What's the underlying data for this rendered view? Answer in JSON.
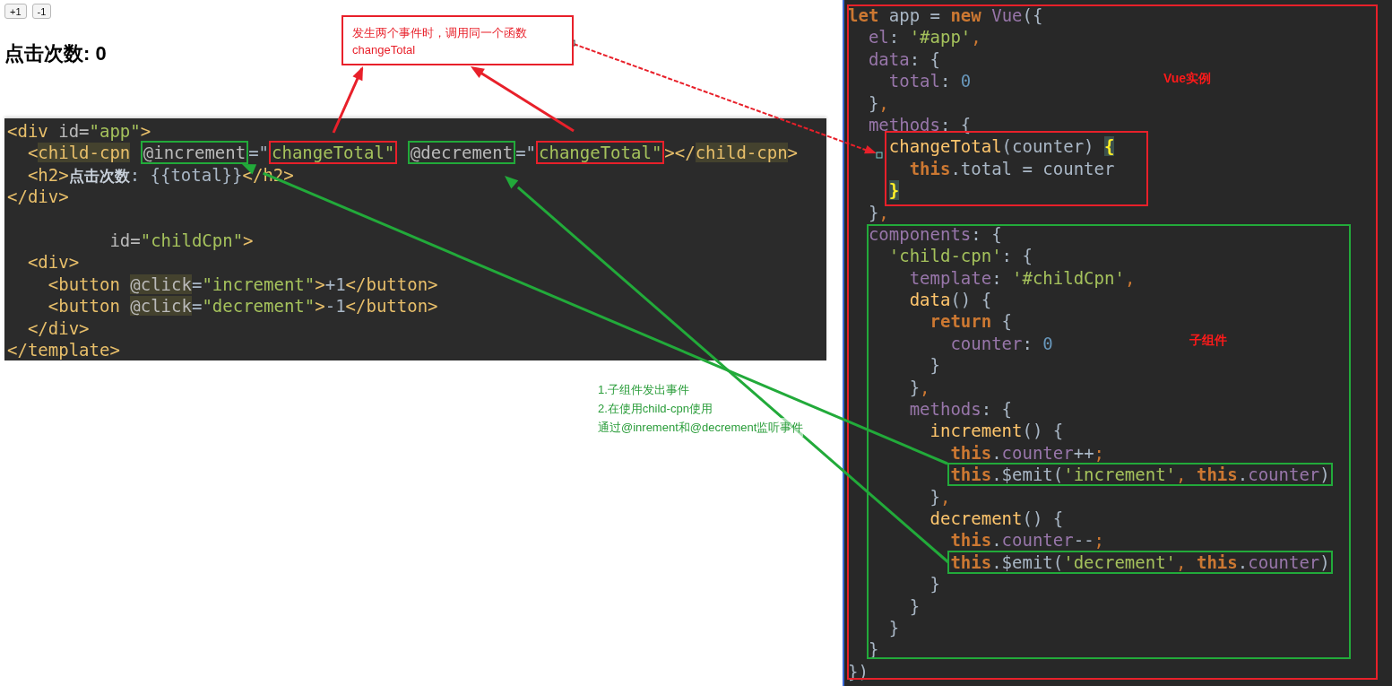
{
  "preview": {
    "buttons": [
      "+1",
      "-1"
    ],
    "heading": "点击次数: 0"
  },
  "callout": {
    "lines": [
      "发生两个事件时，调用同一个函数",
      "changeTotal"
    ]
  },
  "note": {
    "lines": [
      "1.子组件发出事件",
      "2.在使用child-cpn使用",
      "通过@inrement和@decrement监听事件"
    ]
  },
  "template_code": {
    "lines": [
      {
        "kind": "code",
        "tokens": [
          {
            "text": "<div",
            "kind": "tag"
          },
          {
            "text": " id=",
            "kind": "attr"
          },
          {
            "text": "\"app\"",
            "kind": "str"
          },
          {
            "text": ">",
            "kind": "tag"
          }
        ]
      },
      {
        "kind": "code",
        "tokens": [
          {
            "text": "  <",
            "kind": "tag"
          },
          {
            "text": "child-cpn",
            "kind": "tag",
            "highlight": true
          },
          {
            "text": " @increment",
            "kind": "attr",
            "color": "#22aa3a"
          },
          {
            "text": "=\"",
            "kind": "plain"
          },
          {
            "text": "changeTotal\"",
            "kind": "str",
            "color": "#e8202a"
          },
          {
            "text": " @decrement",
            "kind": "attr",
            "color": "#22aa3a"
          },
          {
            "text": "=\"",
            "kind": "plain"
          },
          {
            "text": "changeTotal\"",
            "kind": "str",
            "color": "#e8202a"
          },
          {
            "text": "></",
            "kind": "tag"
          },
          {
            "text": "child-cpn",
            "kind": "tag",
            "highlight": true
          },
          {
            "text": ">",
            "kind": "tag"
          }
        ]
      },
      {
        "kind": "code",
        "tokens": [
          {
            "text": "  <h2>",
            "kind": "tag"
          },
          {
            "text": "点击次数",
            "kind": "cjk"
          },
          {
            "text": ": {{total}}",
            "kind": "plain"
          },
          {
            "text": "</h2>",
            "kind": "tag"
          }
        ]
      },
      {
        "kind": "code",
        "tokens": [
          {
            "text": "</div>",
            "kind": "tag"
          }
        ]
      },
      {
        "kind": "blank"
      },
      {
        "kind": "code",
        "tokens": [
          {
            "text": "          id=",
            "kind": "attr"
          },
          {
            "text": "\"childCpn\"",
            "kind": "str"
          },
          {
            "text": ">",
            "kind": "tag"
          }
        ]
      },
      {
        "kind": "code",
        "tokens": [
          {
            "text": "  <div>",
            "kind": "tag"
          }
        ]
      },
      {
        "kind": "code",
        "tokens": [
          {
            "text": "    <button",
            "kind": "tag"
          },
          {
            "text": " @click",
            "kind": "attr",
            "highlight": true
          },
          {
            "text": "=",
            "kind": "plain"
          },
          {
            "text": "\"increment\"",
            "kind": "str"
          },
          {
            "text": ">",
            "kind": "tag"
          },
          {
            "text": "+1",
            "kind": "plain"
          },
          {
            "text": "</button>",
            "kind": "tag"
          }
        ]
      },
      {
        "kind": "code",
        "tokens": [
          {
            "text": "    <button",
            "kind": "tag"
          },
          {
            "text": " @click",
            "kind": "attr",
            "highlight": true
          },
          {
            "text": "=",
            "kind": "plain"
          },
          {
            "text": "\"decrement\"",
            "kind": "str"
          },
          {
            "text": ">",
            "kind": "tag"
          },
          {
            "text": "-1",
            "kind": "plain"
          },
          {
            "text": "</button>",
            "kind": "tag"
          }
        ]
      },
      {
        "kind": "code",
        "tokens": [
          {
            "text": "  </div>",
            "kind": "tag"
          }
        ]
      },
      {
        "kind": "code",
        "tokens": [
          {
            "text": "</template>",
            "kind": "tag"
          }
        ]
      }
    ]
  },
  "script_code": {
    "labels": [
      "Vue实例",
      "子组件"
    ],
    "lines": [
      {
        "kind": "code",
        "tokens": [
          {
            "text": "let",
            "kind": "kw"
          },
          {
            "text": " app = ",
            "kind": "plain"
          },
          {
            "text": "new",
            "kind": "kw"
          },
          {
            "text": " Vue",
            "kind": "prop"
          },
          {
            "text": "({",
            "kind": "plain"
          }
        ]
      },
      {
        "kind": "code",
        "tokens": [
          {
            "text": "  el",
            "kind": "prop"
          },
          {
            "text": ": ",
            "kind": "plain"
          },
          {
            "text": "'#app'",
            "kind": "str"
          },
          {
            "text": ",",
            "kind": "punct"
          }
        ]
      },
      {
        "kind": "code",
        "tokens": [
          {
            "text": "  data",
            "kind": "prop"
          },
          {
            "text": ": {",
            "kind": "plain"
          }
        ]
      },
      {
        "kind": "code",
        "tokens": [
          {
            "text": "    total",
            "kind": "prop"
          },
          {
            "text": ": ",
            "kind": "plain"
          },
          {
            "text": "0",
            "kind": "num"
          }
        ]
      },
      {
        "kind": "code",
        "tokens": [
          {
            "text": "  }",
            "kind": "plain"
          },
          {
            "text": ",",
            "kind": "punct"
          }
        ]
      },
      {
        "kind": "code",
        "tokens": [
          {
            "text": "  methods",
            "kind": "prop"
          },
          {
            "text": ": {",
            "kind": "plain"
          }
        ]
      },
      {
        "kind": "code",
        "tokens": [
          {
            "text": "    changeTotal",
            "kind": "fn"
          },
          {
            "text": "(counter) ",
            "kind": "plain"
          },
          {
            "text": "{",
            "kind": "brace"
          }
        ]
      },
      {
        "kind": "code",
        "tokens": [
          {
            "text": "      this",
            "kind": "kw"
          },
          {
            "text": ".total = counter",
            "kind": "plain"
          }
        ]
      },
      {
        "kind": "code",
        "tokens": [
          {
            "text": "    }",
            "kind": "brace"
          }
        ]
      },
      {
        "kind": "code",
        "tokens": [
          {
            "text": "  }",
            "kind": "plain"
          },
          {
            "text": ",",
            "kind": "punct"
          }
        ]
      },
      {
        "kind": "code",
        "tokens": [
          {
            "text": "  components",
            "kind": "prop"
          },
          {
            "text": ": {",
            "kind": "plain"
          }
        ]
      },
      {
        "kind": "code",
        "tokens": [
          {
            "text": "    'child-cpn'",
            "kind": "str"
          },
          {
            "text": ": {",
            "kind": "plain"
          }
        ]
      },
      {
        "kind": "code",
        "tokens": [
          {
            "text": "      template",
            "kind": "prop"
          },
          {
            "text": ": ",
            "kind": "plain"
          },
          {
            "text": "'#childCpn'",
            "kind": "str"
          },
          {
            "text": ",",
            "kind": "punct"
          }
        ]
      },
      {
        "kind": "code",
        "tokens": [
          {
            "text": "      data",
            "kind": "fn"
          },
          {
            "text": "() {",
            "kind": "plain"
          }
        ]
      },
      {
        "kind": "code",
        "tokens": [
          {
            "text": "        return",
            "kind": "kw"
          },
          {
            "text": " {",
            "kind": "plain"
          }
        ]
      },
      {
        "kind": "code",
        "tokens": [
          {
            "text": "          counter",
            "kind": "prop"
          },
          {
            "text": ": ",
            "kind": "plain"
          },
          {
            "text": "0",
            "kind": "num"
          }
        ]
      },
      {
        "kind": "code",
        "tokens": [
          {
            "text": "        }",
            "kind": "plain"
          }
        ]
      },
      {
        "kind": "code",
        "tokens": [
          {
            "text": "      }",
            "kind": "plain"
          },
          {
            "text": ",",
            "kind": "punct"
          }
        ]
      },
      {
        "kind": "code",
        "tokens": [
          {
            "text": "      methods",
            "kind": "prop"
          },
          {
            "text": ": {",
            "kind": "plain"
          }
        ]
      },
      {
        "kind": "code",
        "tokens": [
          {
            "text": "        increment",
            "kind": "fn"
          },
          {
            "text": "() {",
            "kind": "plain"
          }
        ]
      },
      {
        "kind": "code",
        "tokens": [
          {
            "text": "          this",
            "kind": "kw"
          },
          {
            "text": ".",
            "kind": "plain"
          },
          {
            "text": "counter",
            "kind": "prop"
          },
          {
            "text": "++",
            "kind": "plain"
          },
          {
            "text": ";",
            "kind": "punct"
          }
        ]
      },
      {
        "kind": "code",
        "color": "#22aa3a",
        "tokens": [
          {
            "text": "          this",
            "kind": "kw"
          },
          {
            "text": ".$emit(",
            "kind": "plain"
          },
          {
            "text": "'increment'",
            "kind": "str"
          },
          {
            "text": ",",
            "kind": "punct"
          },
          {
            "text": " this",
            "kind": "kw"
          },
          {
            "text": ".",
            "kind": "plain"
          },
          {
            "text": "counter",
            "kind": "prop"
          },
          {
            "text": ")",
            "kind": "plain"
          }
        ]
      },
      {
        "kind": "code",
        "tokens": [
          {
            "text": "        }",
            "kind": "plain"
          },
          {
            "text": ",",
            "kind": "punct"
          }
        ]
      },
      {
        "kind": "code",
        "tokens": [
          {
            "text": "        decrement",
            "kind": "fn"
          },
          {
            "text": "() {",
            "kind": "plain"
          }
        ]
      },
      {
        "kind": "code",
        "tokens": [
          {
            "text": "          this",
            "kind": "kw"
          },
          {
            "text": ".",
            "kind": "plain"
          },
          {
            "text": "counter",
            "kind": "prop"
          },
          {
            "text": "--",
            "kind": "plain"
          },
          {
            "text": ";",
            "kind": "punct"
          }
        ]
      },
      {
        "kind": "code",
        "color": "#22aa3a",
        "tokens": [
          {
            "text": "          this",
            "kind": "kw"
          },
          {
            "text": ".$emit(",
            "kind": "plain"
          },
          {
            "text": "'decrement'",
            "kind": "str"
          },
          {
            "text": ",",
            "kind": "punct"
          },
          {
            "text": " this",
            "kind": "kw"
          },
          {
            "text": ".",
            "kind": "plain"
          },
          {
            "text": "counter",
            "kind": "prop"
          },
          {
            "text": ")",
            "kind": "plain"
          }
        ]
      },
      {
        "kind": "code",
        "tokens": [
          {
            "text": "        }",
            "kind": "plain"
          }
        ]
      },
      {
        "kind": "code",
        "tokens": [
          {
            "text": "      }",
            "kind": "plain"
          }
        ]
      },
      {
        "kind": "code",
        "tokens": [
          {
            "text": "    }",
            "kind": "plain"
          }
        ]
      },
      {
        "kind": "code",
        "tokens": [
          {
            "text": "  }",
            "kind": "plain"
          }
        ]
      },
      {
        "kind": "code",
        "tokens": [
          {
            "text": "})",
            "kind": "plain"
          }
        ]
      }
    ]
  }
}
